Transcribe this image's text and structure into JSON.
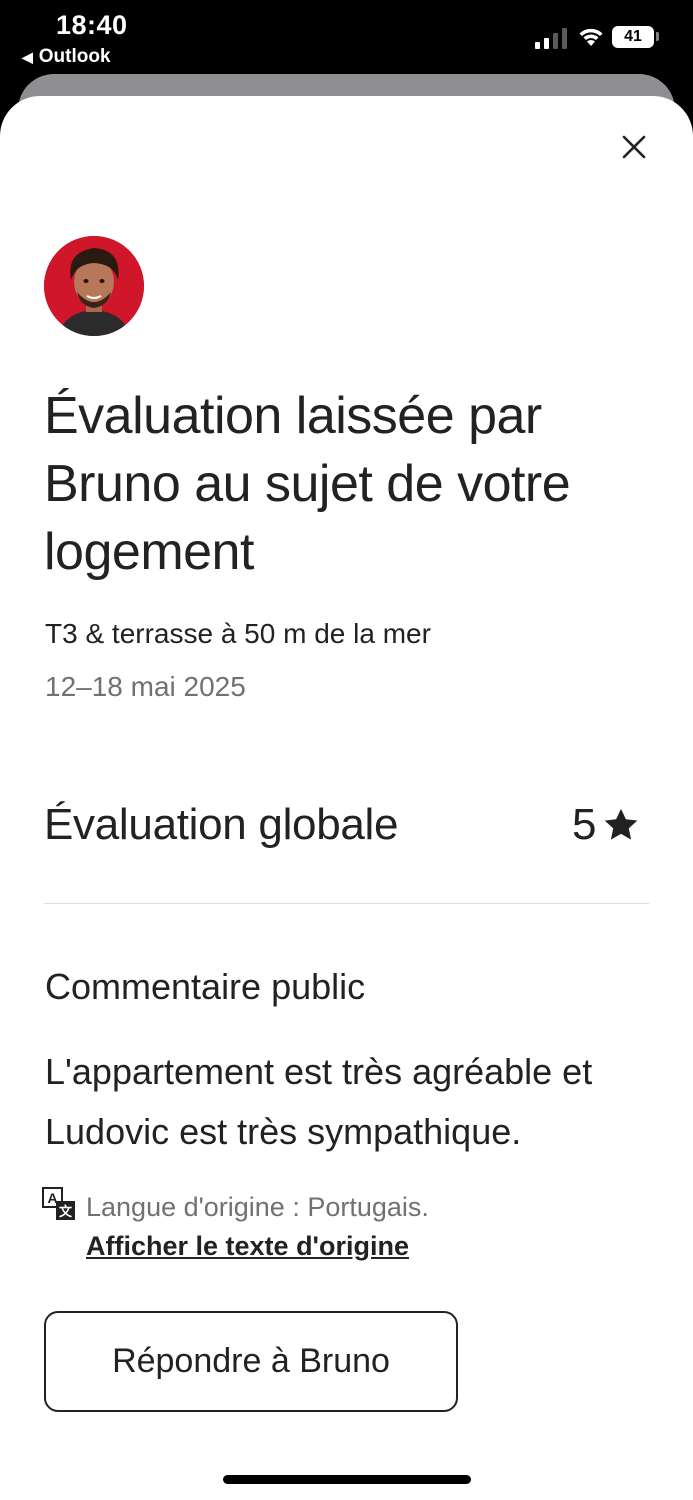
{
  "status_bar": {
    "time": "18:40",
    "back_app": "Outlook",
    "battery": "41",
    "icons": [
      "signal-icon",
      "wifi-icon",
      "battery-icon"
    ]
  },
  "modal": {
    "close_icon": "close-icon",
    "avatar_alt": "avatar",
    "title": "Évaluation laissée par Bruno au sujet de votre logement",
    "listing_name": "T3 & terrasse à 50 m de la mer",
    "stay_dates": "12–18 mai 2025",
    "overall_label": "Évaluation globale",
    "overall_value": "5",
    "rating_icon": "star-icon",
    "comment_heading": "Commentaire public",
    "comment_text": "L'appartement est très agréable et Ludovic est très sympathique.",
    "language_note": "Langue d'origine : Portugais.",
    "show_original_link": "Afficher le texte d'origine",
    "reply_button": "Répondre à Bruno"
  },
  "colors": {
    "text_primary": "#222222",
    "text_secondary": "#717171",
    "divider": "#dddddd",
    "avatar_background": "#d0162a"
  }
}
